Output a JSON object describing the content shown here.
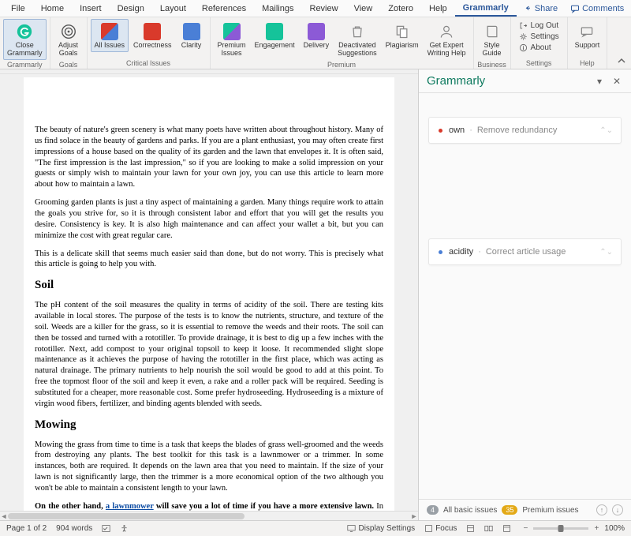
{
  "tabs": [
    "File",
    "Home",
    "Insert",
    "Design",
    "Layout",
    "References",
    "Mailings",
    "Review",
    "View",
    "Zotero",
    "Help",
    "Grammarly"
  ],
  "active_tab_index": 11,
  "topright": {
    "share": "Share",
    "comments": "Comments"
  },
  "ribbon": {
    "grammarly": {
      "close": "Close\nGrammarly",
      "group": "Grammarly"
    },
    "goals": {
      "adjust": "Adjust\nGoals",
      "group": "Goals"
    },
    "critical": {
      "all": "All Issues",
      "correctness": "Correctness",
      "clarity": "Clarity",
      "group": "Critical Issues"
    },
    "premium": {
      "premium_issues": "Premium\nIssues",
      "engagement": "Engagement",
      "delivery": "Delivery",
      "deactivated": "Deactivated\nSuggestions",
      "plagiarism": "Plagiarism",
      "expert": "Get Expert\nWriting Help",
      "group": "Premium"
    },
    "business": {
      "style": "Style\nGuide",
      "group": "Business"
    },
    "settings": {
      "logout": "Log Out",
      "settings": "Settings",
      "about": "About",
      "group": "Settings"
    },
    "help": {
      "support": "Support",
      "group": "Help"
    }
  },
  "grammarly_pane": {
    "title": "Grammarly",
    "issues": [
      {
        "color": "red",
        "word": "own",
        "desc": "Remove redundancy"
      },
      {
        "color": "blue",
        "word": "acidity",
        "desc": "Correct article usage"
      }
    ],
    "footer": {
      "basic_count": "4",
      "basic_label": "All basic issues",
      "premium_count": "35",
      "premium_label": "Premium issues"
    }
  },
  "document": {
    "p1": "The beauty of nature's green scenery is what many poets have written about throughout history. Many of us find solace in the beauty of gardens and parks. If you are a plant enthusiast, you may often create first impressions of a house based on the quality of its garden and the lawn that envelopes it. It is often said, \"The first impression is the last impression,\" so if you are looking to make a solid impression on your guests or simply wish to maintain your lawn for your own joy, you can use this article to learn more about how to maintain a lawn.",
    "p2": "Grooming garden plants is just a tiny aspect of maintaining a garden. Many things require work to attain the goals you strive for, so it is through consistent labor and effort that you will get the results you desire. Consistency is key. It is also high maintenance and can affect your wallet a bit, but you can minimize the cost with great regular care.",
    "p3": "This is a delicate skill that seems much easier said than done, but do not worry. This is precisely what this article is going to help you with.",
    "h1": "Soil",
    "p4": "The pH content of the soil measures the quality in terms of acidity of the soil. There are testing kits available in local stores. The purpose of the tests is to know the nutrients, structure, and texture of the soil. Weeds are a killer for the grass, so it is essential to remove the weeds and their roots. The soil can then be tossed and turned with a rototiller. To provide drainage, it is best to dig up a few inches with the rototiller. Next, add compost to your original topsoil to keep it loose. It recommended slight slope maintenance as it achieves the purpose of having the rototiller in the first place, which was acting as natural drainage. The primary nutrients to help nourish the soil would be good to add at this point. To free the topmost floor of the soil and keep it even, a rake and a roller pack will be required. Seeding is substituted for a cheaper, more reasonable cost. Some prefer hydroseeding. Hydroseeding is a mixture of virgin wood fibers, fertilizer, and binding agents blended with seeds.",
    "h2": "Mowing",
    "p5": "Mowing the grass from time to time is a task that keeps the blades of grass well-groomed and the weeds from destroying any plants. The best toolkit for this task is a lawnmower or a trimmer. In some instances, both are required. It depends on the lawn area that you need to maintain. If the size of your lawn is not significantly large, then the trimmer is a more economical option of the two although you won't be able to maintain a consistent length to your lawn.",
    "p6_a": "On the other hand, ",
    "p6_link": "a lawnmower",
    "p6_b": " will save you a lot of time if you have a more extensive lawn.",
    "p6_c": " In such instances, a trimmer is a huge and bothersome ordeal. The task that would take"
  },
  "status": {
    "page": "Page 1 of 2",
    "words": "904 words",
    "display": "Display Settings",
    "focus": "Focus",
    "zoom": "100%"
  }
}
